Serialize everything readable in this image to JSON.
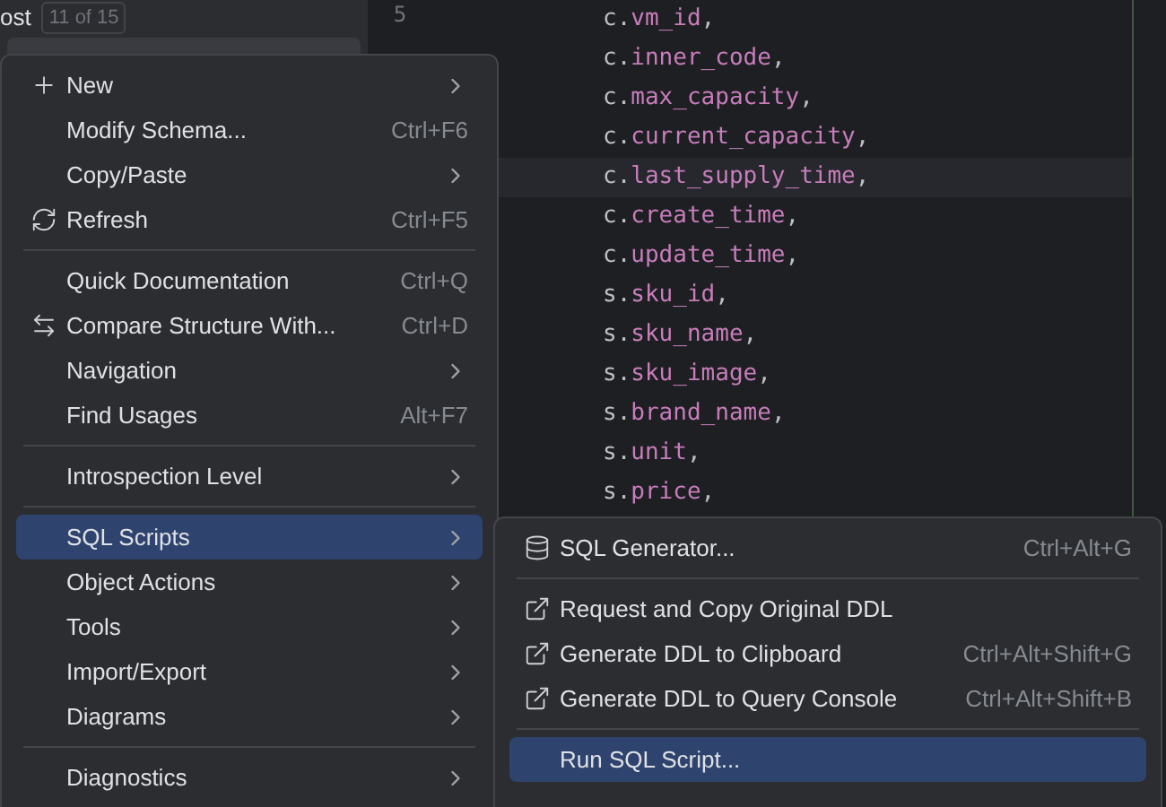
{
  "tree_header": {
    "label": "ost",
    "badge": "11 of 15"
  },
  "gutter": {
    "line_numbers": [
      "5"
    ]
  },
  "code_lines": [
    {
      "prefix": "c.",
      "field": "vm_id",
      "suffix": ",",
      "current": false
    },
    {
      "prefix": "c.",
      "field": "inner_code",
      "suffix": ",",
      "current": false
    },
    {
      "prefix": "c.",
      "field": "max_capacity",
      "suffix": ",",
      "current": false
    },
    {
      "prefix": "c.",
      "field": "current_capacity",
      "suffix": ",",
      "current": false
    },
    {
      "prefix": "c.",
      "field": "last_supply_time",
      "suffix": ",",
      "current": true
    },
    {
      "prefix": "c.",
      "field": "create_time",
      "suffix": ",",
      "current": false
    },
    {
      "prefix": "c.",
      "field": "update_time",
      "suffix": ",",
      "current": false
    },
    {
      "prefix": "s.",
      "field": "sku_id",
      "suffix": ",",
      "current": false
    },
    {
      "prefix": "s.",
      "field": "sku_name",
      "suffix": ",",
      "current": false
    },
    {
      "prefix": "s.",
      "field": "sku_image",
      "suffix": ",",
      "current": false
    },
    {
      "prefix": "s.",
      "field": "brand_name",
      "suffix": ",",
      "current": false
    },
    {
      "prefix": "s.",
      "field": "unit",
      "suffix": ",",
      "current": false
    },
    {
      "prefix": "s.",
      "field": "price",
      "suffix": ",",
      "current": false
    }
  ],
  "context_menu": [
    {
      "kind": "item",
      "label": "New",
      "submenu": true,
      "selected": false
    },
    {
      "kind": "item",
      "label": "Modify Schema...",
      "shortcut": "Ctrl+F6",
      "selected": false
    },
    {
      "kind": "item",
      "label": "Copy/Paste",
      "submenu": true,
      "selected": false
    },
    {
      "kind": "item",
      "label": "Refresh",
      "shortcut": "Ctrl+F5",
      "selected": false
    },
    {
      "kind": "separator"
    },
    {
      "kind": "item",
      "label": "Quick Documentation",
      "shortcut": "Ctrl+Q",
      "selected": false
    },
    {
      "kind": "item",
      "label": "Compare Structure With...",
      "shortcut": "Ctrl+D",
      "selected": false
    },
    {
      "kind": "item",
      "label": "Navigation",
      "submenu": true,
      "selected": false
    },
    {
      "kind": "item",
      "label": "Find Usages",
      "shortcut": "Alt+F7",
      "selected": false
    },
    {
      "kind": "separator"
    },
    {
      "kind": "item",
      "label": "Introspection Level",
      "submenu": true,
      "selected": false
    },
    {
      "kind": "separator"
    },
    {
      "kind": "item",
      "label": "SQL Scripts",
      "submenu": true,
      "selected": true
    },
    {
      "kind": "item",
      "label": "Object Actions",
      "submenu": true,
      "selected": false
    },
    {
      "kind": "item",
      "label": "Tools",
      "submenu": true,
      "selected": false
    },
    {
      "kind": "item",
      "label": "Import/Export",
      "submenu": true,
      "selected": false
    },
    {
      "kind": "item",
      "label": "Diagrams",
      "submenu": true,
      "selected": false
    },
    {
      "kind": "separator"
    },
    {
      "kind": "item",
      "label": "Diagnostics",
      "submenu": true,
      "selected": false
    }
  ],
  "submenu": [
    {
      "kind": "item",
      "label": "SQL Generator...",
      "shortcut": "Ctrl+Alt+G",
      "selected": false
    },
    {
      "kind": "separator"
    },
    {
      "kind": "item",
      "label": "Request and Copy Original DDL",
      "selected": false
    },
    {
      "kind": "item",
      "label": "Generate DDL to Clipboard",
      "shortcut": "Ctrl+Alt+Shift+G",
      "selected": false
    },
    {
      "kind": "item",
      "label": "Generate DDL to Query Console",
      "shortcut": "Ctrl+Alt+Shift+B",
      "selected": false
    },
    {
      "kind": "separator"
    },
    {
      "kind": "item",
      "label": "Run SQL Script...",
      "selected": true
    }
  ]
}
